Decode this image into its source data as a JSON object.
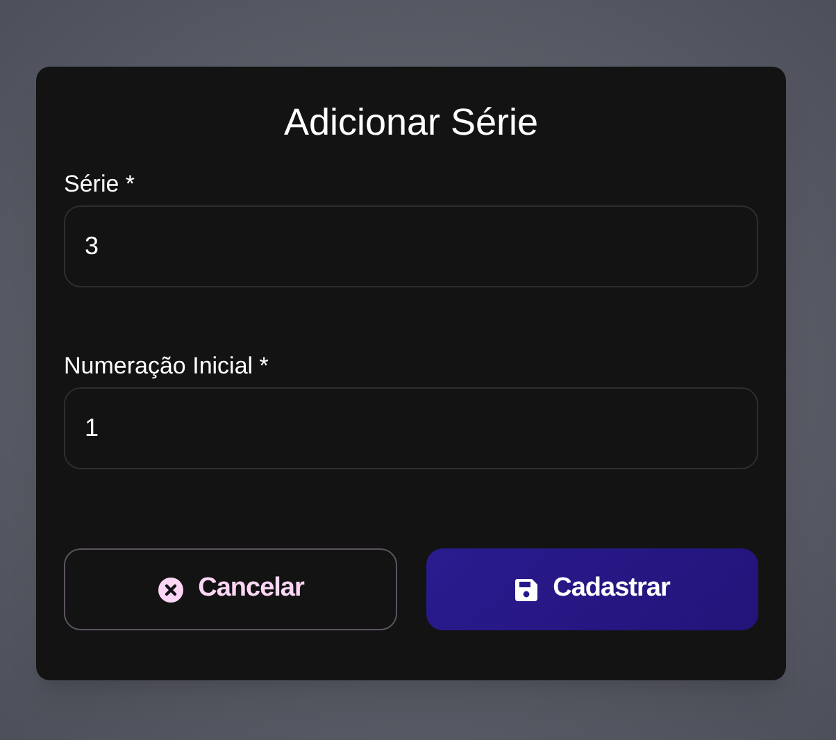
{
  "dialog": {
    "title": "Adicionar Série"
  },
  "fields": [
    {
      "label": "Série *",
      "value": "3"
    },
    {
      "label": "Numeração Inicial *",
      "value": "1"
    }
  ],
  "buttons": [
    {
      "label": "Cancelar",
      "kind": "outline"
    },
    {
      "label": "Cadastrar",
      "kind": "primary"
    }
  ]
}
